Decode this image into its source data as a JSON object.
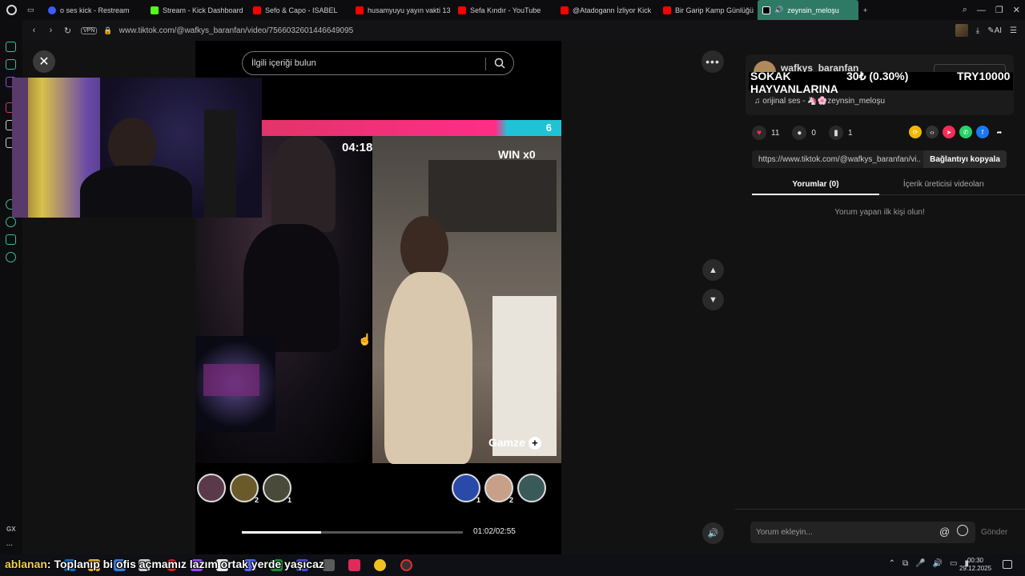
{
  "browser": {
    "tabs": [
      {
        "label": "o ses kick - Restream",
        "color": "#3d5afe"
      },
      {
        "label": "Stream - Kick Dashboard",
        "color": "#53fc18"
      },
      {
        "label": "Sefo & Capo - ISABEL",
        "color": "#ff0000"
      },
      {
        "label": "husamyuyu yayın vakti 13",
        "color": "#ff0000"
      },
      {
        "label": "Sefa Kındır - YouTube",
        "color": "#ff0000"
      },
      {
        "label": "@Atadogann İzliyor Kick",
        "color": "#ff0000"
      },
      {
        "label": "Bir Garip Kamp Günlüğü",
        "color": "#ff0000"
      },
      {
        "label": "zeynsin_meloşu",
        "color": "#000000",
        "active": true
      }
    ],
    "new_tab": "+",
    "url": "www.tiktok.com/@wafkys_baranfan/video/7566032601446649095",
    "vpn": "VPN",
    "ai_label": "AI"
  },
  "video": {
    "search_placeholder": "İlgili içeriği bulun",
    "battle_score": "6",
    "timer": "04:18",
    "win_label": "WIN x0",
    "guest_name": "Gamze",
    "left_counts": [
      "",
      "2",
      "1"
    ],
    "right_counts": [
      "1",
      "2",
      ""
    ],
    "progress": 0.36,
    "time": "01:02/02:55"
  },
  "panel": {
    "author": "wafkys_baranfan",
    "sound": "orijinal ses - 🦄🌸zeynsin_meloşu",
    "likes": "11",
    "comments": "0",
    "bookmarks": "1",
    "link": "https://www.tiktok.com/@wafkys_baranfan/vi...",
    "copy_link": "Bağlantıyı kopyala",
    "tab_comments": "Yorumlar (0)",
    "tab_creator": "İçerik üreticisi videoları",
    "empty_message": "Yorum yapan ilk kişi olun!",
    "comment_placeholder": "Yorum ekleyin...",
    "send": "Gönder"
  },
  "donation": {
    "title_line1": "SOKAK",
    "title_line2": "HAYVANLARINA",
    "amount": "30₺ (0.30%)",
    "goal": "TRY10000"
  },
  "chat_overlay": {
    "user": "ablanan",
    "message": ": Toplanıp bi ofis açmamız lazım ortak yerde yaşıcaz"
  },
  "taskbar": {
    "time": "00:30",
    "date": "29.12.2025"
  },
  "colors": {
    "accent": "#2f7a64",
    "tiktok_pink": "#ff2d87",
    "tiktok_cyan": "#20c3d6"
  }
}
